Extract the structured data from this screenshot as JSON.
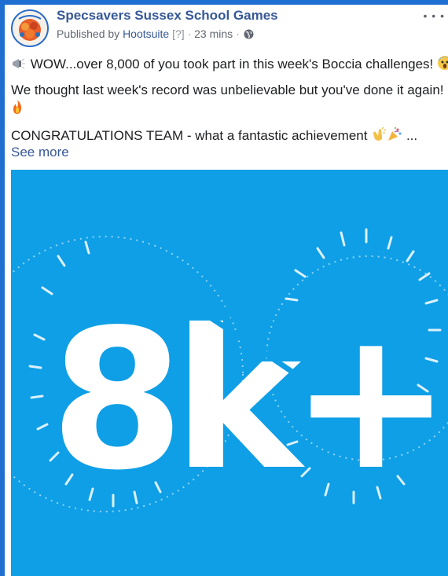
{
  "post": {
    "page_name": "Specsavers Sussex School Games",
    "published_by_prefix": "Published by",
    "published_by_link": "Hootsuite",
    "help_marker": "[?]",
    "separator": "·",
    "time": "23 mins",
    "separator2": "·",
    "privacy_icon": "globe-icon",
    "more_icon": "ellipsis-icon",
    "line1": "WOW...over 8,000 of you took part in this week's Boccia challenges!",
    "line2": "We thought last week's record was unbelievable but you've done it again!",
    "line3": "CONGRATULATIONS TEAM - what a fantastic achievement",
    "line3_suffix": "...",
    "see_more": "See more",
    "emojis": [
      "megaphone-emoji",
      "scream-emoji",
      "fire-emoji",
      "fire-emoji",
      "clap-emoji",
      "party-popper-emoji"
    ]
  },
  "image": {
    "headline": "8k+",
    "background": "#0e9fe6",
    "foreground": "#ffffff"
  }
}
